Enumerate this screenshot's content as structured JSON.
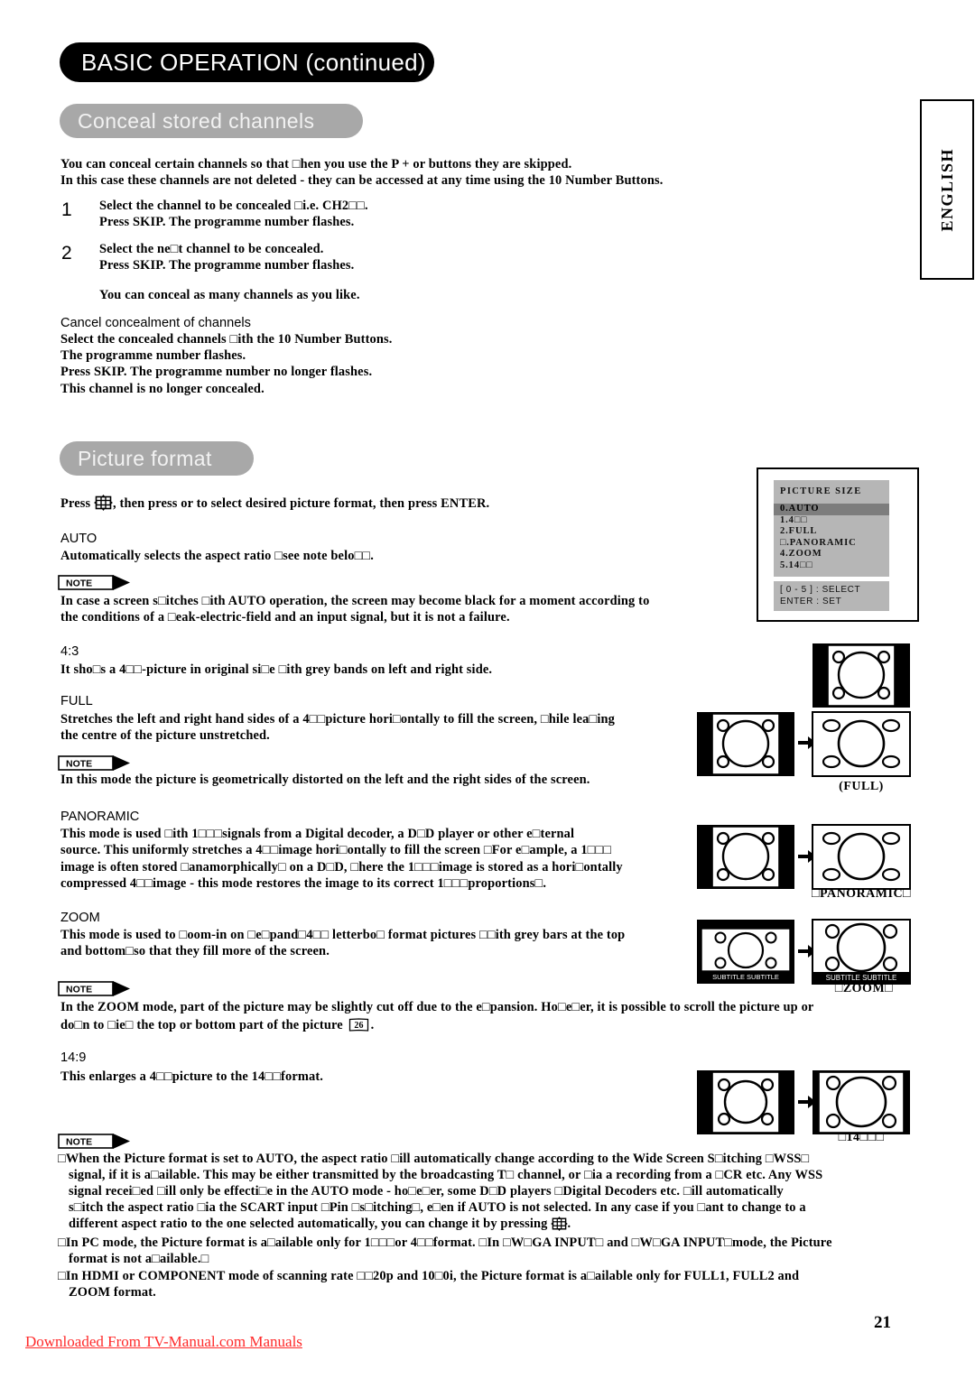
{
  "header": {
    "banner_title": "BASIC OPERATION (continued)",
    "language_tab": "ENGLISH"
  },
  "sections": {
    "conceal": {
      "pill_title": "Conceal stored channels",
      "intro_line1": "You can conceal certain channels so that □hen you use the P + or   buttons they are skipped.",
      "intro_line2": "In this case these channels are not deleted - they can be accessed at any time using the 10 Number Buttons.",
      "steps": [
        {
          "number": "1",
          "line1": "Select the channel to be concealed □i.e. CH2□□.",
          "line2": "Press SKIP. The programme number flashes."
        },
        {
          "number": "2",
          "line1": "Select the ne□t channel to be concealed.",
          "line2": "Press SKIP. The programme number flashes."
        }
      ],
      "note_after_steps": "You can conceal as many channels as you like.",
      "cancel_heading": "Cancel concealment of channels",
      "cancel_lines": [
        "Select the concealed channels □ith the 10 Number Buttons.",
        "The programme number flashes.",
        "Press SKIP. The programme number no longer flashes.",
        "This channel is no longer concealed."
      ]
    },
    "picture_format": {
      "pill_title": "Picture format",
      "press_line_before_icon": "Press ",
      "press_line_after_icon": ", then press     or     to select desired picture format, then press ENTER.",
      "modes": [
        {
          "name": "AUTO",
          "body": [
            "Automatically selects the aspect ratio □see note belo□□."
          ],
          "note": [
            "In case a screen s□itches □ith AUTO operation, the screen may become black for a moment according to",
            "the conditions of a □eak-electric-field and an input signal, but it is not a failure."
          ]
        },
        {
          "name": "4:3",
          "body": [
            "It sho□s a 4□□-picture in original si□e □ith grey bands on left and right side."
          ],
          "note": []
        },
        {
          "name": "FULL",
          "body": [
            "Stretches the left and right hand sides of a 4□□picture hori□ontally to fill the screen, □hile lea□ing",
            "the centre of the picture unstretched."
          ],
          "note": [
            "In this mode the picture is geometrically distorted on the left and the right sides of the screen."
          ]
        },
        {
          "name": "PANORAMIC",
          "body": [
            "This mode is used □ith 1□□□signals from a Digital decoder, a D□D player or other e□ternal",
            "source. This uniformly stretches a 4□□image hori□ontally to fill the screen □For e□ample, a 1□□□",
            "image is often stored □anamorphically□ on a D□D, □here the 1□□□image is stored as a hori□ontally",
            "compressed 4□□image - this mode restores the image to its correct 1□□□proportions□."
          ],
          "note": []
        },
        {
          "name": "ZOOM",
          "body": [
            "This mode is used to □oom-in on □e□pand□4□□ letterbo□ format pictures □□ith grey bars at the top",
            "and bottom□so that they fill more of the screen."
          ],
          "note": [
            "In the ZOOM mode, part of the picture may be slightly cut off due to the e□pansion. Ho□e□er, it is possible to scroll the picture up or",
            "do□n to □ie□ the top or bottom part of the picture"
          ],
          "note_page_ref": "26",
          "note_tail": "."
        },
        {
          "name": "14:9",
          "body": [
            "This enlarges a 4□□picture to the 14□□format."
          ],
          "note": []
        }
      ],
      "illustration_captions": {
        "full": "(FULL)",
        "panoramic": "□PANORAMIC□",
        "zoom": "□ZOOM□",
        "fourteen_nine": "□14□□□",
        "subtitle_text": "SUBTITLE SUBTITLE"
      },
      "osd": {
        "title": "PICTURE SIZE",
        "items": [
          "0.AUTO",
          "1.4□□",
          "2.FULL",
          "□.PANORAMIC",
          "4.ZOOM",
          "5.14□□"
        ],
        "selected_index": 0,
        "footer_line1": "[ 0 - 5 ] : SELECT",
        "footer_line2": "ENTER : SET"
      },
      "final_note_bullets": [
        [
          "□When the Picture format is set to AUTO, the aspect ratio □ill automatically change according to the Wide Screen S□itching □WSS□",
          "signal, if it is a□ailable. This may be either transmitted by the broadcasting T□ channel, or □ia a recording from a □CR etc. Any WSS",
          "signal recei□ed □ill only be effecti□e in the AUTO mode - ho□e□er, some D□D players □Digital Decoders etc. □ill automatically",
          "s□itch the aspect ratio □ia the SCART input □Pin □s□itching□, e□en if AUTO is not selected. In any case if you □ant to change to a",
          "different aspect ratio to the one selected automatically, you can change it by pressing"
        ],
        [
          "□In PC mode, the Picture format is a□ailable only for 1□□□or 4□□format. □In □W□GA INPUT□ and □W□GA INPUT□mode, the Picture",
          "format is not a□ailable.□"
        ],
        [
          "□In HDMI or COMPONENT mode of scanning rate □□20p and 10□0i, the Picture format is a□ailable only for FULL1, FULL2 and",
          "ZOOM format."
        ]
      ]
    }
  },
  "note_badge_label": "NOTE",
  "footer": {
    "download_link": "Downloaded From TV-Manual.com Manuals",
    "page_number": "21"
  },
  "colors": {
    "banner_bg": "#000000",
    "pill_bg": "#a8a8a8",
    "osd_panel": "#b6b6b6",
    "osd_selected": "#7d7d7d",
    "footer_link": "#ff2a2a"
  }
}
